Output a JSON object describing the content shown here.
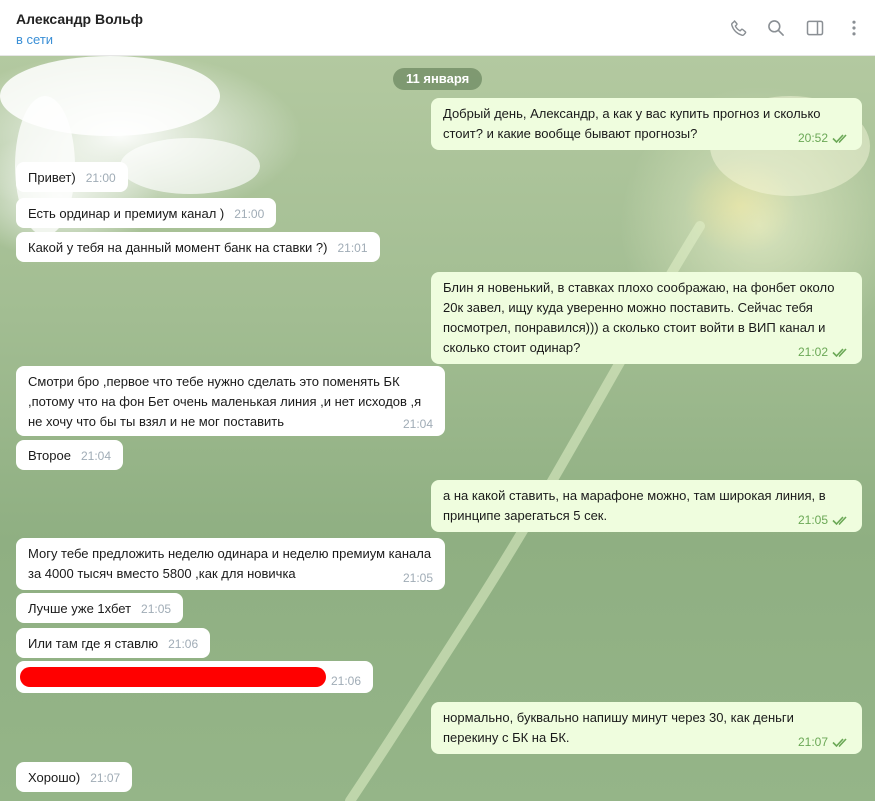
{
  "header": {
    "name": "Александр Вольф",
    "status": "в сети",
    "icons": [
      "phone-icon",
      "search-icon",
      "sidebar-icon",
      "more-icon"
    ]
  },
  "chat": {
    "date": "11 января",
    "messages": [
      {
        "dir": "out",
        "text": "Добрый день, Александр, а как у вас купить прогноз и сколько стоит? и какие вообще бывают прогнозы?",
        "time": "20:52"
      },
      {
        "dir": "in",
        "text": "Привет)",
        "time": "21:00"
      },
      {
        "dir": "in",
        "text": "Есть ординар и премиум канал )",
        "time": "21:00"
      },
      {
        "dir": "in",
        "text": "Какой у тебя на данный момент банк на ставки ?)",
        "time": "21:01"
      },
      {
        "dir": "out",
        "text": "Блин я новенький, в ставках плохо соображаю, на фонбет около 20к завел, ищу куда уверенно можно поставить. Сейчас тебя посмотрел, понравился))) а сколько стоит войти в ВИП канал и сколько стоит одинар?",
        "time": "21:02"
      },
      {
        "dir": "in",
        "text": "Смотри бро ,первое что тебе нужно сделать это поменять БК ,потому что на фон Бет очень маленькая линия ,и нет исходов ,я не хочу что бы ты взял и не мог поставить",
        "time": "21:04"
      },
      {
        "dir": "in",
        "text": "Второе",
        "time": "21:04"
      },
      {
        "dir": "out",
        "text": "а на какой ставить, на марафоне можно, там широкая линия, в принципе зарегаться 5 сек.",
        "time": "21:05"
      },
      {
        "dir": "in",
        "text": "Могу тебе предложить неделю одинара и неделю премиум канала за 4000 тысяч вместо 5800 ,как для новичка",
        "time": "21:05"
      },
      {
        "dir": "in",
        "text": "Лучше уже 1хбет",
        "time": "21:05"
      },
      {
        "dir": "in",
        "text": "Или там где я ставлю",
        "time": "21:06"
      },
      {
        "dir": "in",
        "text": "",
        "time": "21:06"
      },
      {
        "dir": "out",
        "text": "нормально, буквально напишу минут через 30, как деньги перекину с БК на БК.",
        "time": "21:07"
      },
      {
        "dir": "in",
        "text": "Хорошо)",
        "time": "21:07"
      }
    ]
  },
  "colors": {
    "incoming": "#ffffff",
    "outgoing": "#effdde",
    "status": "#3a8fd6",
    "redaction": "#ff0000",
    "read_check": "#6ba856"
  }
}
